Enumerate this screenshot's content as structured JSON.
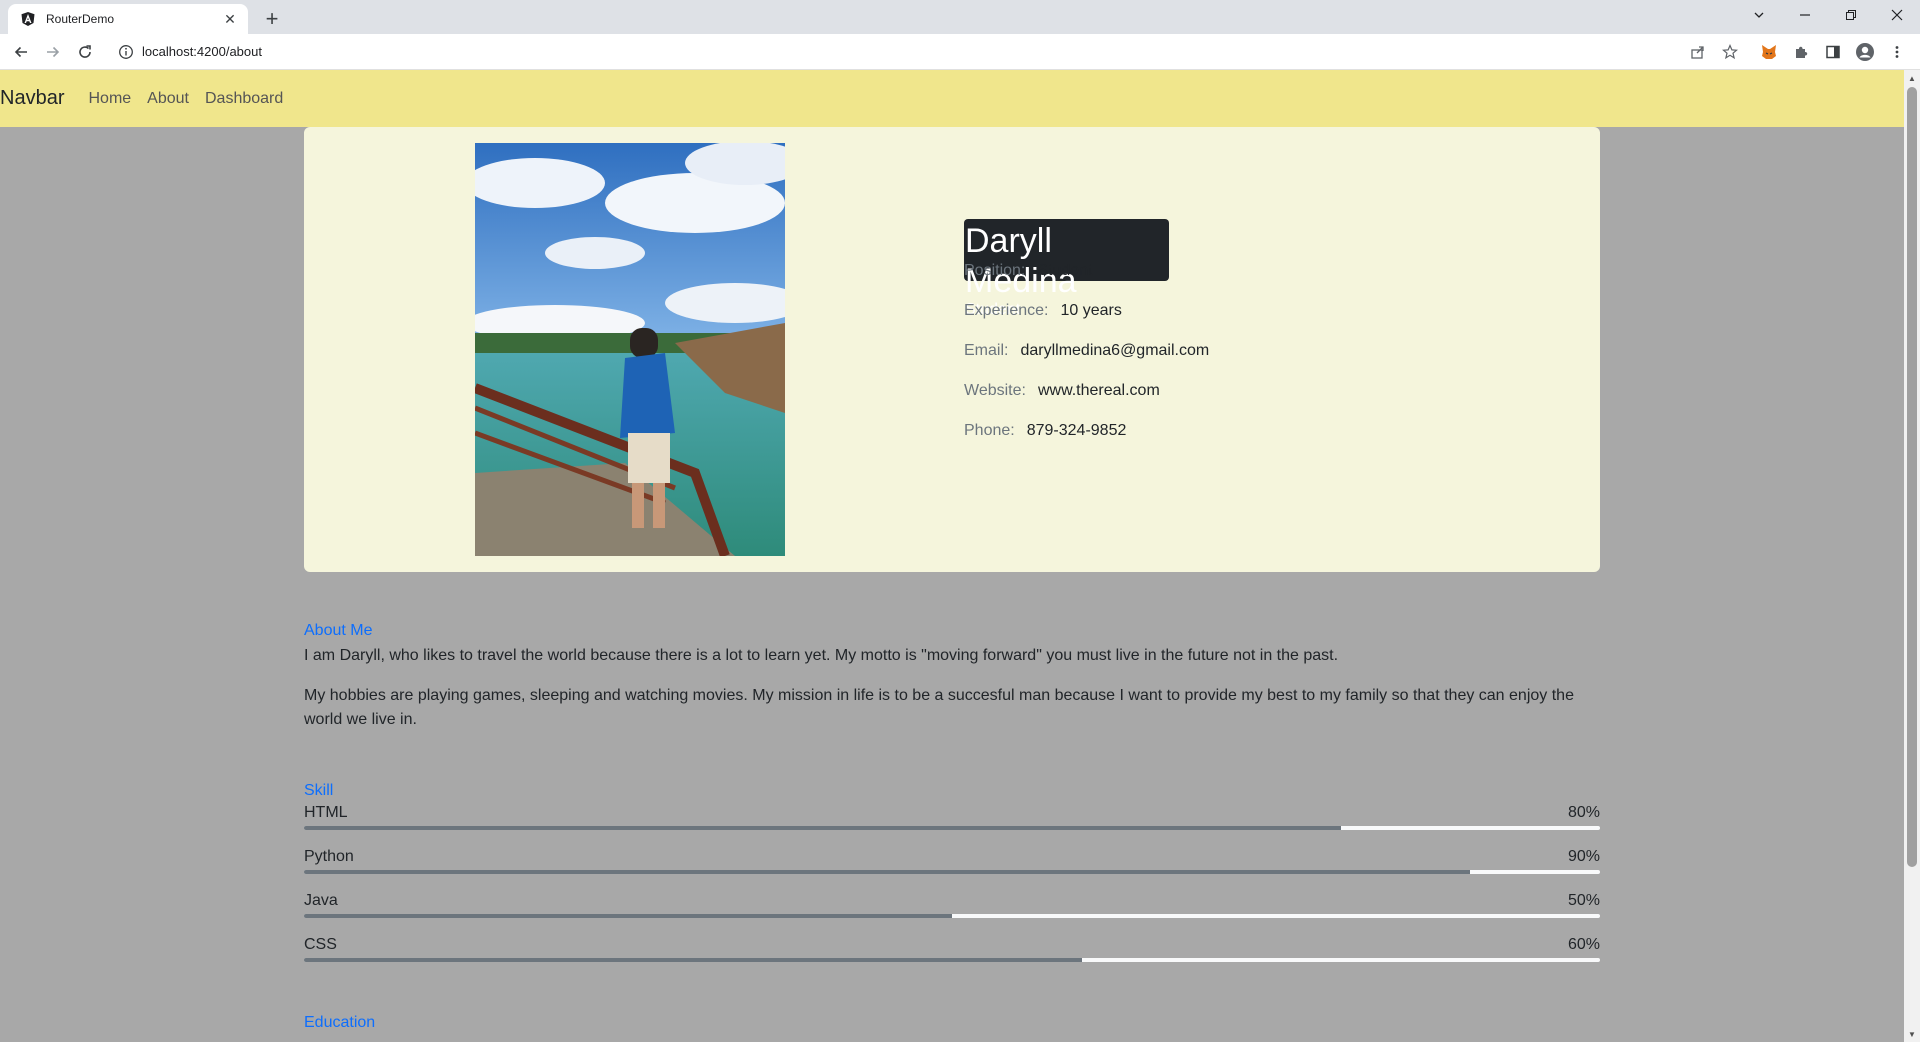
{
  "browser": {
    "tab_title": "RouterDemo",
    "url": "localhost:4200/about"
  },
  "navbar": {
    "brand": "Navbar",
    "links": [
      "Home",
      "About",
      "Dashboard"
    ]
  },
  "profile": {
    "name": "Daryll Medina",
    "role": "Student",
    "fields": [
      {
        "label": "Position:",
        "value": "Student"
      },
      {
        "label": "Experience:",
        "value": "10 years"
      },
      {
        "label": "Email:",
        "value": "daryllmedina6@gmail.com"
      },
      {
        "label": "Website:",
        "value": "www.thereal.com"
      },
      {
        "label": "Phone:",
        "value": "879-324-9852"
      }
    ]
  },
  "about": {
    "title": "About Me",
    "p1": "I am Daryll, who likes to travel the world because there is a lot to learn yet. My motto is \"moving forward\" you must live in the future not in the past.",
    "p2": "My hobbies are playing games, sleeping and watching movies. My mission in life is to be a succesful man because I want to provide my best to my family so that they can enjoy the world we live in."
  },
  "skills": {
    "title": "Skill",
    "items": [
      {
        "name": "HTML",
        "percent_label": "80%",
        "percent": 80
      },
      {
        "name": "Python",
        "percent_label": "90%",
        "percent": 90
      },
      {
        "name": "Java",
        "percent_label": "50%",
        "percent": 50
      },
      {
        "name": "CSS",
        "percent_label": "60%",
        "percent": 60
      }
    ]
  },
  "education": {
    "title": "Education"
  },
  "colors": {
    "navbar_bg": "#f0e68c",
    "card_bg": "#f5f5dc",
    "page_bg": "#a8a8a8",
    "accent": "#0d6efd"
  },
  "icons": {
    "favicon": "angular-logo-icon",
    "back": "arrow-left-icon",
    "forward": "arrow-right-icon",
    "reload": "reload-icon",
    "info": "info-icon",
    "share": "share-icon",
    "star": "star-icon",
    "fox": "metamask-fox-icon",
    "extensions": "puzzle-icon",
    "sidepanel": "side-panel-icon",
    "profile": "profile-icon",
    "menu": "kebab-menu-icon"
  }
}
